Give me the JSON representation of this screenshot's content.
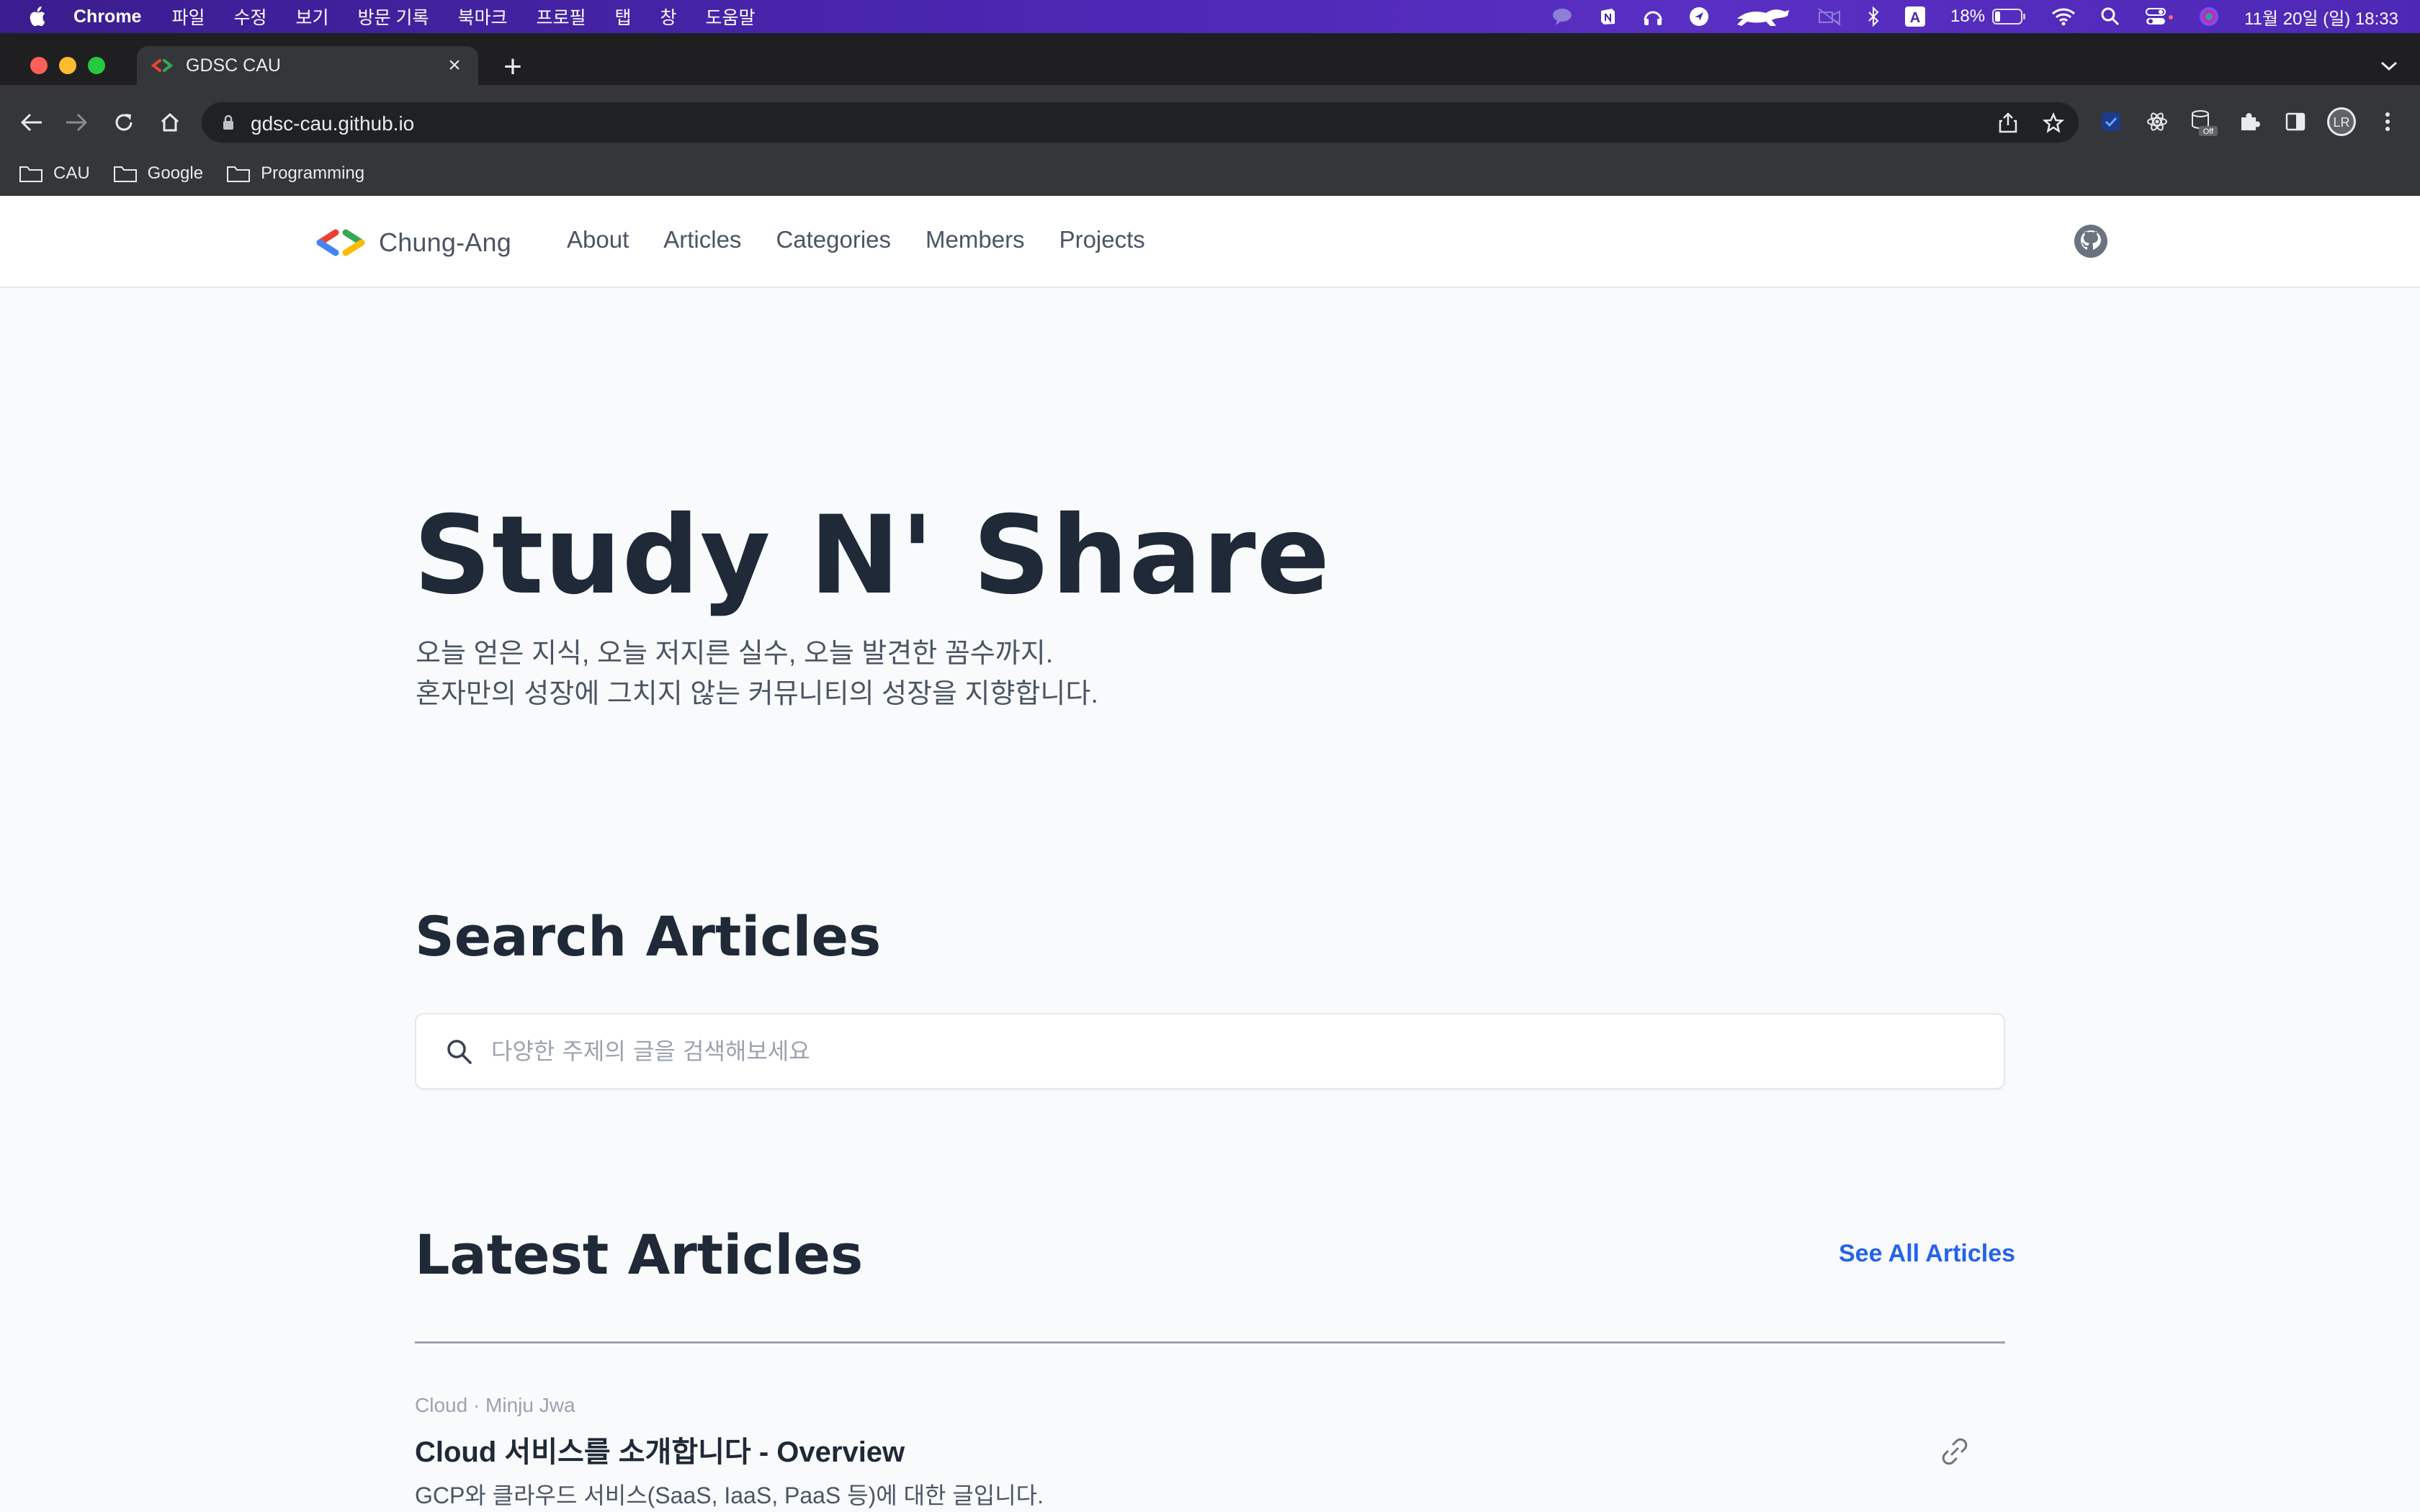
{
  "menubar": {
    "app_name": "Chrome",
    "menus": [
      "파일",
      "수정",
      "보기",
      "방문 기록",
      "북마크",
      "프로필",
      "탭",
      "창",
      "도움말"
    ],
    "battery": "18%",
    "datetime": "11월 20일 (일)  18:33"
  },
  "browser": {
    "tab_title": "GDSC CAU",
    "url": "gdsc-cau.github.io",
    "bookmarks": [
      "CAU",
      "Google",
      "Programming"
    ],
    "profile_initials": "LR",
    "extension_badge": "Off"
  },
  "site": {
    "logo_text": "Chung-Ang",
    "nav": [
      "About",
      "Articles",
      "Categories",
      "Members",
      "Projects"
    ],
    "hero_title": "Study N' Share",
    "hero_sub_line1": "오늘 얻은 지식, 오늘 저지른 실수, 오늘 발견한 꼼수까지.",
    "hero_sub_line2": "혼자만의 성장에 그치지 않는 커뮤니티의 성장을 지향합니다.",
    "search_title": "Search Articles",
    "search_placeholder": "다양한 주제의 글을 검색해보세요",
    "latest_title": "Latest Articles",
    "see_all": "See All Articles",
    "articles": [
      {
        "meta": "Cloud · Minju Jwa",
        "title": "Cloud 서비스를 소개합니다 - Overview",
        "description": "GCP와 클라우드 서비스(SaaS, IaaS, PaaS 등)에 대한 글입니다."
      }
    ]
  },
  "colors": {
    "accent": "#2563eb",
    "text_dark": "#1f2937",
    "menubar": "#4a26b0",
    "logo_red": "#ea4335",
    "logo_blue": "#4285f4",
    "logo_green": "#34a853",
    "logo_yellow": "#fbbc04"
  }
}
